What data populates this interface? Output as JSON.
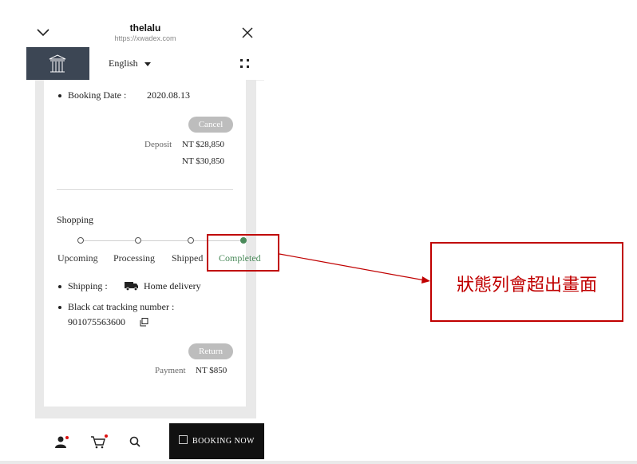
{
  "browser": {
    "title": "thelalu",
    "url": "https://xwadex.com"
  },
  "header": {
    "language": "English"
  },
  "booking": {
    "date_label": "Booking Date :",
    "date_value": "2020.08.13",
    "cancel_label": "Cancel",
    "deposit_label": "Deposit",
    "deposit_value": "NT $28,850",
    "total_value": "NT $30,850"
  },
  "shopping": {
    "title": "Shopping",
    "steps": [
      "Upcoming",
      "Processing",
      "Shipped",
      "Completed"
    ],
    "current_step": 4,
    "shipping_label": "Shipping :",
    "shipping_value": "Home delivery",
    "tracking_label": "Black cat tracking number :",
    "tracking_number": "901075563600",
    "return_label": "Return",
    "payment_label": "Payment",
    "payment_value": "NT $850"
  },
  "bottom_nav": {
    "booking_now": "BOOKING NOW"
  },
  "annotation": {
    "note": "狀態列會超出畫面"
  },
  "colors": {
    "accent_dark": "#3c4654",
    "step_done": "#4a8a5a",
    "annotation": "#c00000"
  },
  "icons": [
    "chevron-down-icon",
    "close-icon",
    "pavilion-logo-icon",
    "caret-down-icon",
    "menu-grid-icon",
    "truck-icon",
    "copy-icon",
    "user-icon",
    "cart-icon",
    "search-icon",
    "booking-icon"
  ]
}
